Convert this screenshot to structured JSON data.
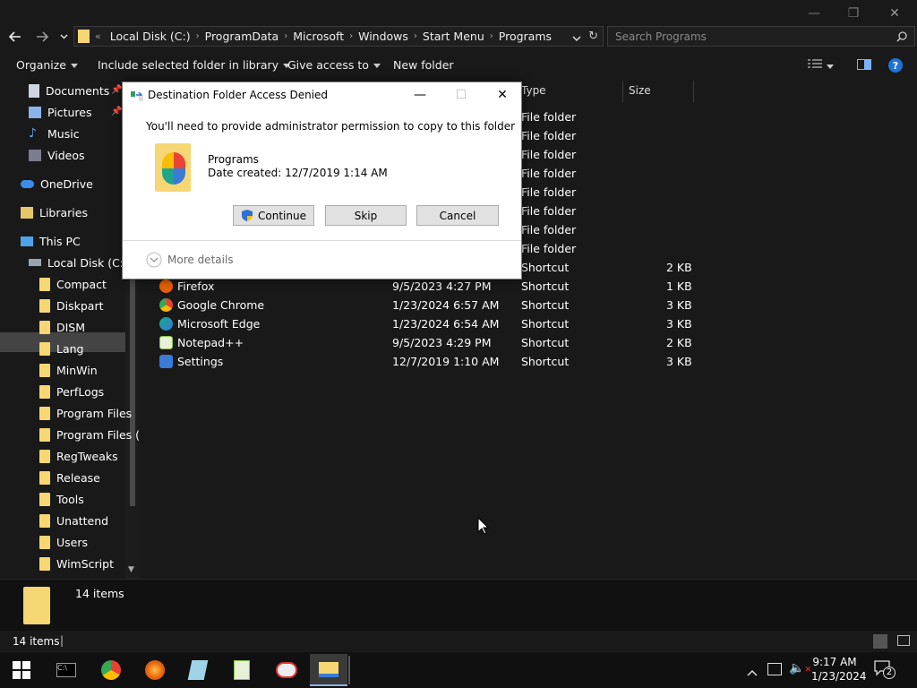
{
  "window": {
    "minimize_icon": "—",
    "maximize_icon": "❐",
    "close_icon": "✕"
  },
  "address": {
    "crumbs": [
      "Local Disk (C:)",
      "ProgramData",
      "Microsoft",
      "Windows",
      "Start Menu",
      "Programs"
    ],
    "search_placeholder": "Search Programs",
    "overflow": "«"
  },
  "commands": {
    "organize": "Organize",
    "include": "Include selected folder in library",
    "give_access": "Give access to",
    "new_folder": "New folder"
  },
  "nav": {
    "items": [
      {
        "label": "Documents",
        "icon": "documents-icon"
      },
      {
        "label": "Pictures",
        "icon": "pictures-icon"
      },
      {
        "label": "Music",
        "icon": "music-icon"
      },
      {
        "label": "Videos",
        "icon": "videos-icon"
      },
      {
        "label": "OneDrive",
        "icon": "onedrive-icon"
      },
      {
        "label": "Libraries",
        "icon": "libraries-icon"
      },
      {
        "label": "This PC",
        "icon": "this-pc-icon"
      },
      {
        "label": "Local Disk (C:)",
        "icon": "drive-icon"
      },
      {
        "label": "Compact",
        "icon": "folder-icon"
      },
      {
        "label": "Diskpart",
        "icon": "folder-icon"
      },
      {
        "label": "DISM",
        "icon": "folder-icon"
      },
      {
        "label": "Lang",
        "icon": "folder-icon"
      },
      {
        "label": "MinWin",
        "icon": "folder-icon"
      },
      {
        "label": "PerfLogs",
        "icon": "folder-icon"
      },
      {
        "label": "Program Files",
        "icon": "folder-icon"
      },
      {
        "label": "Program Files (",
        "icon": "folder-icon"
      },
      {
        "label": "RegTweaks",
        "icon": "folder-icon"
      },
      {
        "label": "Release",
        "icon": "folder-icon"
      },
      {
        "label": "Tools",
        "icon": "folder-icon"
      },
      {
        "label": "Unattend",
        "icon": "folder-icon"
      },
      {
        "label": "Users",
        "icon": "folder-icon"
      },
      {
        "label": "WimScript",
        "icon": "folder-icon"
      }
    ]
  },
  "columns": {
    "type": "Type",
    "size": "Size"
  },
  "files": [
    {
      "name": "",
      "date": "",
      "type": "File folder",
      "size": ""
    },
    {
      "name": "",
      "date": "",
      "type": "File folder",
      "size": ""
    },
    {
      "name": "",
      "date": "",
      "type": "File folder",
      "size": ""
    },
    {
      "name": "",
      "date": "",
      "type": "File folder",
      "size": ""
    },
    {
      "name": "",
      "date": "",
      "type": "File folder",
      "size": ""
    },
    {
      "name": "",
      "date": "",
      "type": "File folder",
      "size": ""
    },
    {
      "name": "",
      "date": "",
      "type": "File folder",
      "size": ""
    },
    {
      "name": "",
      "date": "",
      "type": "File folder",
      "size": ""
    },
    {
      "name": "",
      "date": "",
      "type": "Shortcut",
      "size": "2 KB"
    },
    {
      "name": "Firefox",
      "date": "9/5/2023 4:27 PM",
      "type": "Shortcut",
      "size": "1 KB",
      "color": "#e66000"
    },
    {
      "name": "Google Chrome",
      "date": "1/23/2024 6:57 AM",
      "type": "Shortcut",
      "size": "3 KB",
      "color": "#4285f4"
    },
    {
      "name": "Microsoft Edge",
      "date": "1/23/2024 6:54 AM",
      "type": "Shortcut",
      "size": "3 KB",
      "color": "#1fa58a"
    },
    {
      "name": "Notepad++",
      "date": "9/5/2023 4:29 PM",
      "type": "Shortcut",
      "size": "2 KB",
      "color": "#8bc34a"
    },
    {
      "name": "Settings",
      "date": "12/7/2019 1:10 AM",
      "type": "Shortcut",
      "size": "3 KB",
      "color": "#3a7bd5"
    }
  ],
  "details": {
    "count": "14 items"
  },
  "status": {
    "count": "14 items"
  },
  "dialog": {
    "title": "Destination Folder Access Denied",
    "message": "You'll need to provide administrator permission to copy to this folder",
    "folder_name": "Programs",
    "date_created": "Date created: 12/7/2019 1:14 AM",
    "continue": "Continue",
    "skip": "Skip",
    "cancel": "Cancel",
    "more_details": "More details"
  },
  "taskbar": {
    "time": "9:17 AM",
    "date": "1/23/2024",
    "notification_count": "2"
  }
}
